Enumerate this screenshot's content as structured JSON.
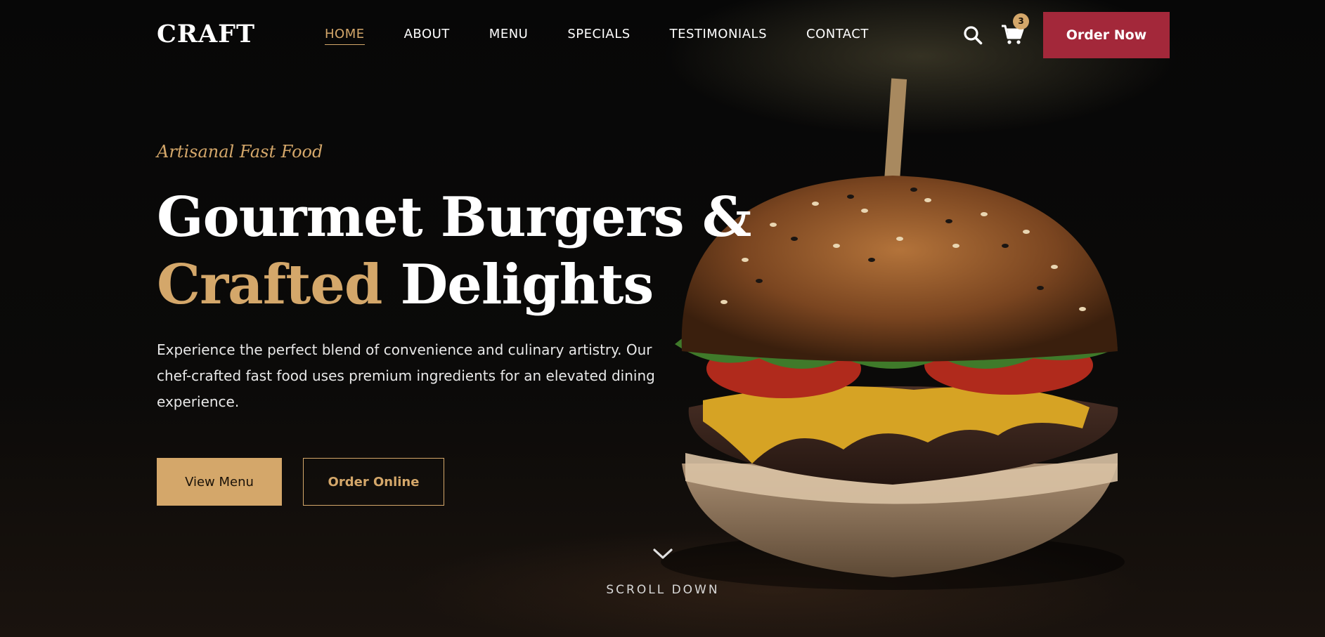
{
  "brand": {
    "logo": "CRAFT"
  },
  "nav": {
    "links": [
      {
        "label": "HOME",
        "active": true
      },
      {
        "label": "ABOUT",
        "active": false
      },
      {
        "label": "MENU",
        "active": false
      },
      {
        "label": "SPECIALS",
        "active": false
      },
      {
        "label": "TESTIMONIALS",
        "active": false
      },
      {
        "label": "CONTACT",
        "active": false
      }
    ],
    "search_icon": "search-icon",
    "cart_icon": "cart-icon",
    "cart_count": "3",
    "order_button": "Order Now"
  },
  "hero": {
    "tagline": "Artisanal Fast Food",
    "headline_line1": "Gourmet Burgers &",
    "headline_accent": "Crafted",
    "headline_rest": " Delights",
    "description": "Experience the perfect blend of convenience and culinary artistry. Our chef-crafted fast food uses premium ingredients for an elevated dining experience.",
    "primary_button": "View Menu",
    "secondary_button": "Order Online",
    "scroll_icon": "chevron-down-icon",
    "scroll_label": "SCROLL DOWN"
  },
  "colors": {
    "accent_gold": "#d4a76a",
    "cta_red": "#a3283a",
    "background": "#0a0a0a"
  }
}
